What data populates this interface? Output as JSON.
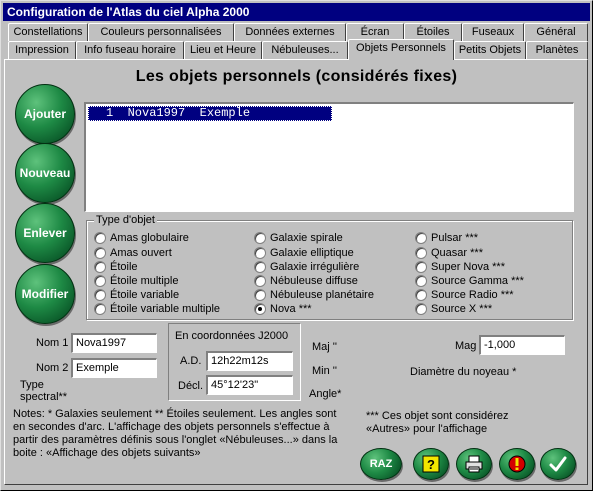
{
  "window": {
    "title": "Configuration de l'Atlas du ciel Alpha 2000"
  },
  "tabs_row1": [
    "Constellations",
    "Couleurs personnalisées",
    "Données externes",
    "Écran",
    "Étoiles",
    "Fuseaux",
    "Général"
  ],
  "tabs_row2": [
    "Impression",
    "Info fuseau horaire",
    "Lieu et Heure",
    "Nébuleuses...",
    "Objets Personnels",
    "Petits Objets",
    "Planètes"
  ],
  "active_tab": "Objets Personnels",
  "heading": "Les objets personnels (considérés fixes)",
  "side_buttons": {
    "add": "Ajouter",
    "new": "Nouveau",
    "remove": "Enlever",
    "modify": "Modifier"
  },
  "object_list": {
    "items": [
      "1  Nova1997  Exemple"
    ],
    "selected_index": 0
  },
  "object_type": {
    "title": "Type d'objet",
    "col1": [
      "Amas globulaire",
      "Amas ouvert",
      "Étoile",
      "Étoile multiple",
      "Étoile variable",
      "Étoile variable multiple"
    ],
    "col2": [
      "Galaxie spirale",
      "Galaxie elliptique",
      "Galaxie irrégulière",
      "Nébuleuse diffuse",
      "Nébuleuse planétaire",
      "Nova ***"
    ],
    "col3": [
      "Pulsar ***",
      "Quasar ***",
      "Super Nova ***",
      "Source Gamma ***",
      "Source Radio ***",
      "Source X ***"
    ],
    "selected": "Nova ***"
  },
  "fields": {
    "nom1_label": "Nom 1",
    "nom1_value": "Nova1997",
    "nom2_label": "Nom 2",
    "nom2_value": "Exemple",
    "type_spectral_label": "Type spectral**",
    "coords_title": "En coordonnées J2000",
    "ad_label": "A.D.",
    "ad_value": "12h22m12s",
    "decl_label": "Décl.",
    "decl_value": "45°12'23\"",
    "maj_label": "Maj ''",
    "min_label": "Min ''",
    "angle_label": "Angle*",
    "mag_label": "Mag",
    "mag_value": "-1,000",
    "diam_label": "Diamètre du noyeau *"
  },
  "notes": {
    "left": "Notes: * Galaxies seulement  ** Étoiles seulement.  Les angles sont en secondes d'arc.  L'affichage des objets personnels s'effectue à partir des paramètres définis sous l'onglet «Nébuleuses...» dans la boite : «Affichage des objets suivants»",
    "right": "*** Ces objet sont considérez «Autres» pour l'affichage"
  },
  "toolbar": {
    "raz_label": "RAZ",
    "help_icon": "question-icon",
    "print_icon": "printer-icon",
    "cancel_icon": "stop-icon",
    "ok_icon": "checkmark-icon"
  },
  "colors": {
    "title_bar": "#000080",
    "button_green": "#1e8a45",
    "selection": "#000080",
    "face": "#c0c0c0"
  }
}
